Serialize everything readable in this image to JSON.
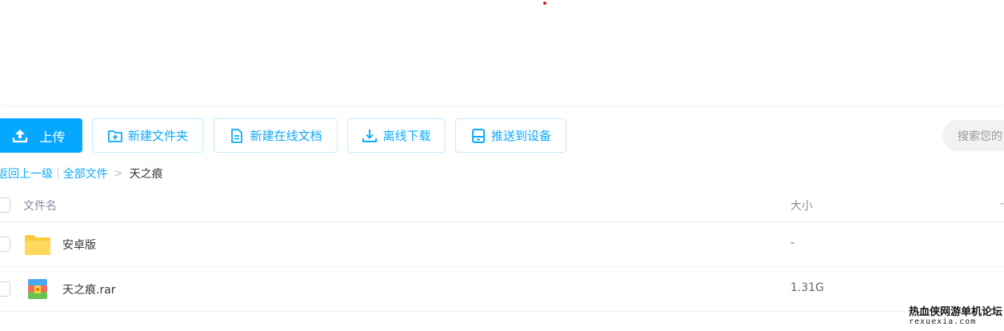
{
  "toolbar": {
    "upload_label": "上传",
    "new_folder_label": "新建文件夹",
    "new_doc_label": "新建在线文档",
    "offline_download_label": "离线下载",
    "push_device_label": "推送到设备"
  },
  "search": {
    "placeholder": "搜索您的"
  },
  "breadcrumb": {
    "back": "返回上一级",
    "separator": "|",
    "all_files": "全部文件",
    "arrow": ">",
    "current": "天之痕"
  },
  "table": {
    "headers": {
      "name": "文件名",
      "size": "大小",
      "more": "-"
    },
    "rows": [
      {
        "name": "安卓版",
        "size": "-",
        "icon": "folder-icon"
      },
      {
        "name": "天之痕.rar",
        "size": "1.31G",
        "icon": "archive-icon"
      }
    ]
  },
  "watermark": {
    "line1": "热血侠网游单机论坛",
    "line2": "rexuexia.com"
  },
  "colors": {
    "accent": "#06a7ff",
    "folder": "#ffd34d",
    "border": "#c3eaff"
  }
}
